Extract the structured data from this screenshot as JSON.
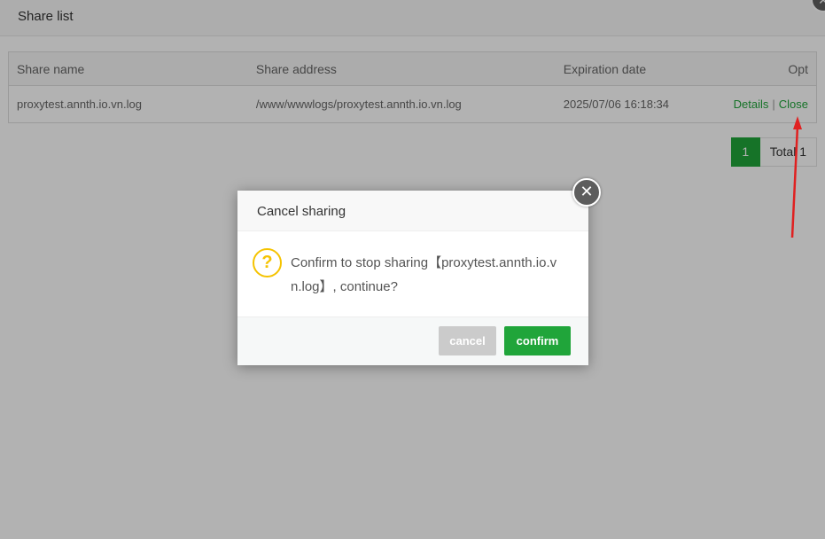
{
  "panel": {
    "title": "Share list",
    "close_icon": "close-icon"
  },
  "table": {
    "headers": [
      "Share name",
      "Share address",
      "Expiration date",
      "Opt"
    ],
    "rows": [
      {
        "name": "proxytest.annth.io.vn.log",
        "address": "/www/wwwlogs/proxytest.annth.io.vn.log",
        "expiration": "2025/07/06 16:18:34",
        "details_label": "Details",
        "separator": "|",
        "close_label": "Close"
      }
    ]
  },
  "pagination": {
    "current_page": "1",
    "total_label": "Total 1"
  },
  "dialog": {
    "title": "Cancel sharing",
    "icon": "?",
    "message": "Confirm to stop sharing【proxytest.annth.io.vn.log】, continue?",
    "cancel_label": "cancel",
    "confirm_label": "confirm"
  },
  "colors": {
    "accent_green": "#20a53a",
    "annotation_arrow": "#e02020",
    "warning_icon": "#f5c300"
  }
}
